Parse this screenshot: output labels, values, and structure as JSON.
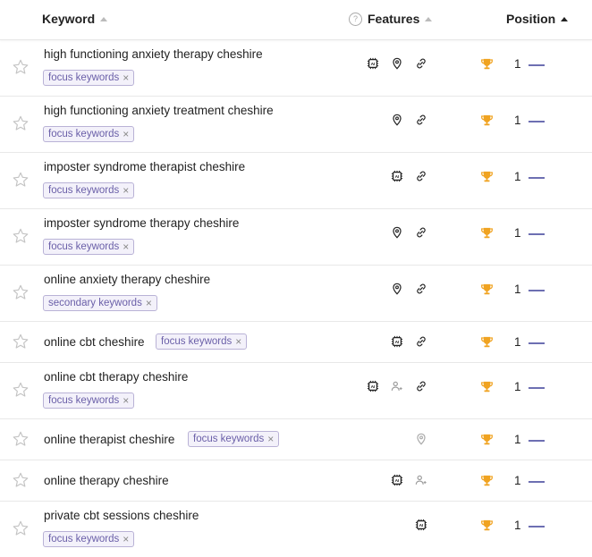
{
  "header": {
    "keyword_label": "Keyword",
    "features_label": "Features",
    "position_label": "Position",
    "help_glyph": "?"
  },
  "tag_remove_glyph": "×",
  "colors": {
    "tag_text": "#6a5fa8",
    "tag_border": "#b9b2d6",
    "tag_bg": "#f3f1fa",
    "trophy": "#f0a321",
    "position_dash": "#6d6fb2",
    "icon_dark": "#222222",
    "icon_muted": "#aaaaaa"
  },
  "rows": [
    {
      "keyword": "high functioning anxiety therapy cheshire",
      "tag": "focus keywords",
      "features": [
        "ai-overview-icon",
        "local-pack-icon",
        "link-icon"
      ],
      "position": "1"
    },
    {
      "keyword": "high functioning anxiety treatment cheshire",
      "tag": "focus keywords",
      "features": [
        "local-pack-icon",
        "link-icon"
      ],
      "position": "1"
    },
    {
      "keyword": "imposter syndrome therapist cheshire",
      "tag": "focus keywords",
      "features": [
        "ai-overview-icon",
        "link-icon"
      ],
      "position": "1"
    },
    {
      "keyword": "imposter syndrome therapy cheshire",
      "tag": "focus keywords",
      "features": [
        "local-pack-icon",
        "link-icon"
      ],
      "position": "1"
    },
    {
      "keyword": "online anxiety therapy cheshire",
      "tag": "secondary keywords",
      "features": [
        "local-pack-icon",
        "link-icon"
      ],
      "position": "1"
    },
    {
      "keyword": "online cbt cheshire",
      "tag": "focus keywords",
      "features": [
        "ai-overview-icon",
        "link-icon"
      ],
      "position": "1"
    },
    {
      "keyword": "online cbt therapy cheshire",
      "tag": "focus keywords",
      "features": [
        "ai-overview-icon",
        "people-also-ask-icon",
        "link-icon"
      ],
      "position": "1"
    },
    {
      "keyword": "online therapist cheshire",
      "tag": "focus keywords",
      "features": [
        "local-pack-icon"
      ],
      "position": "1"
    },
    {
      "keyword": "online therapy cheshire",
      "tag": "",
      "features": [
        "ai-overview-icon",
        "people-also-ask-icon"
      ],
      "position": "1"
    },
    {
      "keyword": "private cbt sessions cheshire",
      "tag": "focus keywords",
      "features": [
        "ai-overview-icon"
      ],
      "position": "1"
    }
  ]
}
